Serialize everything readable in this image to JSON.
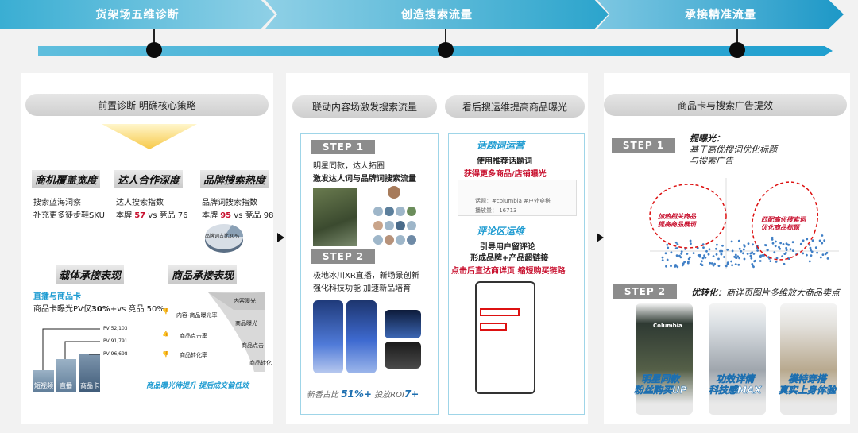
{
  "header": {
    "stage1": "货架场五维诊断",
    "stage2": "创造搜索流量",
    "stage3": "承接精准流量"
  },
  "panel1": {
    "pill": "前置诊断 明确核心策略",
    "dim1": {
      "title": "商机覆盖宽度",
      "line1": "搜索蓝海洞察",
      "line2": "补充更多徒步鞋SKU"
    },
    "dim2": {
      "title": "达人合作深度",
      "line1": "达人搜索指数",
      "line2_a": "本牌 ",
      "line2_b": "57",
      "line2_c": " vs 竞品 76"
    },
    "dim3": {
      "title": "品牌搜索热度",
      "line1": "品牌词搜索指数",
      "line2_a": "本牌 ",
      "line2_b": "95",
      "line2_c": " vs 竞品 98",
      "pie_label": "品牌词占比30%"
    },
    "dim4": {
      "title": "载体承接表现",
      "sub": "直播与商品卡",
      "line_a": "商品卡曝光PV仅",
      "line_b": "30%",
      "line_c": "+vs 竞品 50%"
    },
    "dim5": {
      "title": "商品承接表现"
    },
    "pv": [
      "PV 52,103",
      "PV 91,791",
      "PV 96,698"
    ],
    "bars": [
      "短视频",
      "直播",
      "商品卡"
    ],
    "funnel": [
      "内容曝光",
      "商品曝光",
      "商品点击",
      "商品转化"
    ],
    "rates": [
      "内容-商品曝光率",
      "商品点击率",
      "商品转化率"
    ],
    "footer": "商品曝光待提升 提后成交偏低效"
  },
  "panel2": {
    "pill1": "联动内容场激发搜索流量",
    "pill2": "看后搜运维提高商品曝光",
    "step1": {
      "label": "STEP 1",
      "line1": "明星同款，达人拓圈",
      "line2": "激发达人词与品牌词搜索流量"
    },
    "step2": {
      "label": "STEP 2",
      "line1": "极地冰川XR直播，新场景创新",
      "line2": "强化科技功能 加速新品培育"
    },
    "footer_a": "新香占比",
    "footer_b": "51%+",
    "footer_c": "投放ROI",
    "footer_d": "7+",
    "topic": {
      "title": "话题词运营",
      "line1": "使用推荐话题词",
      "line2": "获得更多商品/店铺曝光",
      "tag": "话题：#columbia #户外穿搭",
      "views": "播放量： 16713"
    },
    "comment": {
      "title": "评论区运维",
      "line1": "引导用户留评论",
      "line2": "形成品牌+产品超链接",
      "line3": "点击后直达商详页 缩短购买链路"
    }
  },
  "panel3": {
    "pill": "商品卡与搜索广告提效",
    "step1": {
      "label": "STEP 1",
      "title": "提曝光：",
      "line1": "基于高优搜词优化标题",
      "line2": "与搜索广告"
    },
    "scatter_left": "加热相关商品\n提高商品展现",
    "scatter_right": "匹配高优搜索词\n优化商品标题",
    "step2": {
      "label": "STEP 2",
      "title": "优转化",
      "rest": "：商详页图片多维放大商品卖点"
    },
    "cards": [
      "明星同款\n粉丝购买UP",
      "功效详情\n科技感MAX",
      "模特穿搭\n真实上身体验"
    ],
    "brand": "Columbia"
  }
}
